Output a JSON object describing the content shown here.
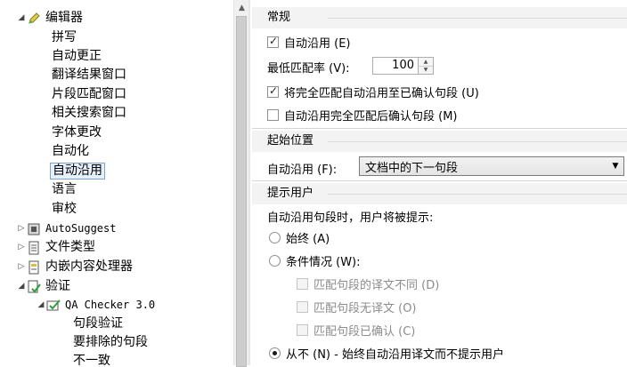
{
  "tree": {
    "editor": {
      "label": "编辑器",
      "expander": "◢"
    },
    "editor_children": [
      "拼写",
      "自动更正",
      "翻译结果窗口",
      "片段匹配窗口",
      "相关搜索窗口",
      "字体更改",
      "自动化",
      "自动沿用",
      "语言",
      "审校"
    ],
    "selected_label": "自动沿用",
    "autosuggest": {
      "label": "AutoSuggest",
      "expander": "▷"
    },
    "file_types": {
      "label": "文件类型",
      "expander": "▷"
    },
    "embedded": {
      "label": "内嵌内容处理器",
      "expander": "▷"
    },
    "verification": {
      "label": "验证",
      "expander": "◢"
    },
    "qa_checker": {
      "label": "QA Checker 3.0",
      "expander": "◢"
    },
    "qa_children": [
      "句段验证",
      "要排除的句段",
      "不一致"
    ]
  },
  "scroll": {
    "up_arrow": "▲"
  },
  "general": {
    "header": "常规",
    "autopropagate_label": "自动沿用 (E)",
    "min_match_label": "最低匹配率 (V):",
    "min_match_value": "100",
    "spin_up": "▲",
    "spin_down": "▼",
    "propagate_exact_label": "将完全匹配自动沿用至已确认句段 (U)",
    "confirm_after_label": "自动沿用完全匹配后确认句段 (M)"
  },
  "start": {
    "header": "起始位置",
    "label": "自动沿用 (F):",
    "value": "文档中的下一句段",
    "arrow": "▼"
  },
  "prompt": {
    "header": "提示用户",
    "description": "自动沿用句段时，用户将被提示:",
    "always_label": "始终 (A)",
    "conditions_label": "条件情况 (W):",
    "cond_different": "匹配句段的译文不同 (D)",
    "cond_no_target": "匹配句段无译文 (O)",
    "cond_confirmed": "匹配句段已确认 (C)",
    "never_label": "从不 (N) - 始终自动沿用译文而不提示用户"
  },
  "colors": {
    "selection_bg": "#e5f0fb",
    "selection_border": "#7da2ce",
    "group_bg": "#f3f3f3"
  }
}
